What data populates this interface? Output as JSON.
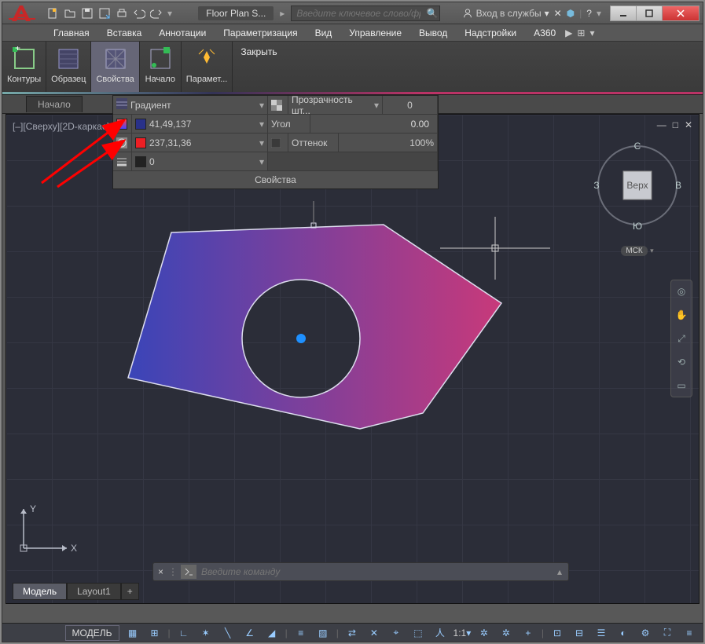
{
  "title": {
    "doc": "Floor Plan S...",
    "search_ph": "Введите ключевое слово/фразу",
    "signin": "Вход в службы"
  },
  "menubar": [
    "Главная",
    "Вставка",
    "Аннотации",
    "Параметризация",
    "Вид",
    "Управление",
    "Вывод",
    "Надстройки",
    "A360"
  ],
  "ribbon": {
    "panels": [
      {
        "label": "Контуры",
        "icon": "boundary",
        "active": false
      },
      {
        "label": "Образец",
        "icon": "pattern",
        "active": false
      },
      {
        "label": "Свойства",
        "icon": "properties",
        "active": true
      },
      {
        "label": "Начало",
        "icon": "origin",
        "active": false
      },
      {
        "label": "Парамет...",
        "icon": "params",
        "active": false
      }
    ],
    "close": "Закрыть"
  },
  "filetab": "Начало",
  "view_label": "[–][Сверху][2D-каркас]",
  "viewcube": {
    "top": "С",
    "right": "В",
    "bottom": "Ю",
    "left": "З",
    "face": "Верх",
    "wcs": "МСК"
  },
  "props": {
    "title": "Свойства",
    "type": "Градиент",
    "color1": {
      "rgb": "41,49,137",
      "hex": "#293189"
    },
    "color2": {
      "rgb": "237,31,36",
      "hex": "#ed1f24"
    },
    "width": "0",
    "transp_label": "Прозрачность шт...",
    "transp_val": "0",
    "angle_label": "Угол",
    "angle_val": "0.00",
    "tint_label": "Оттенок",
    "tint_val": "100%"
  },
  "cmd": {
    "placeholder": "Введите команду"
  },
  "layout_tabs": {
    "model": "Модель",
    "layout1": "Layout1"
  },
  "status": {
    "model": "МОДЕЛЬ",
    "scale": "1:1"
  }
}
